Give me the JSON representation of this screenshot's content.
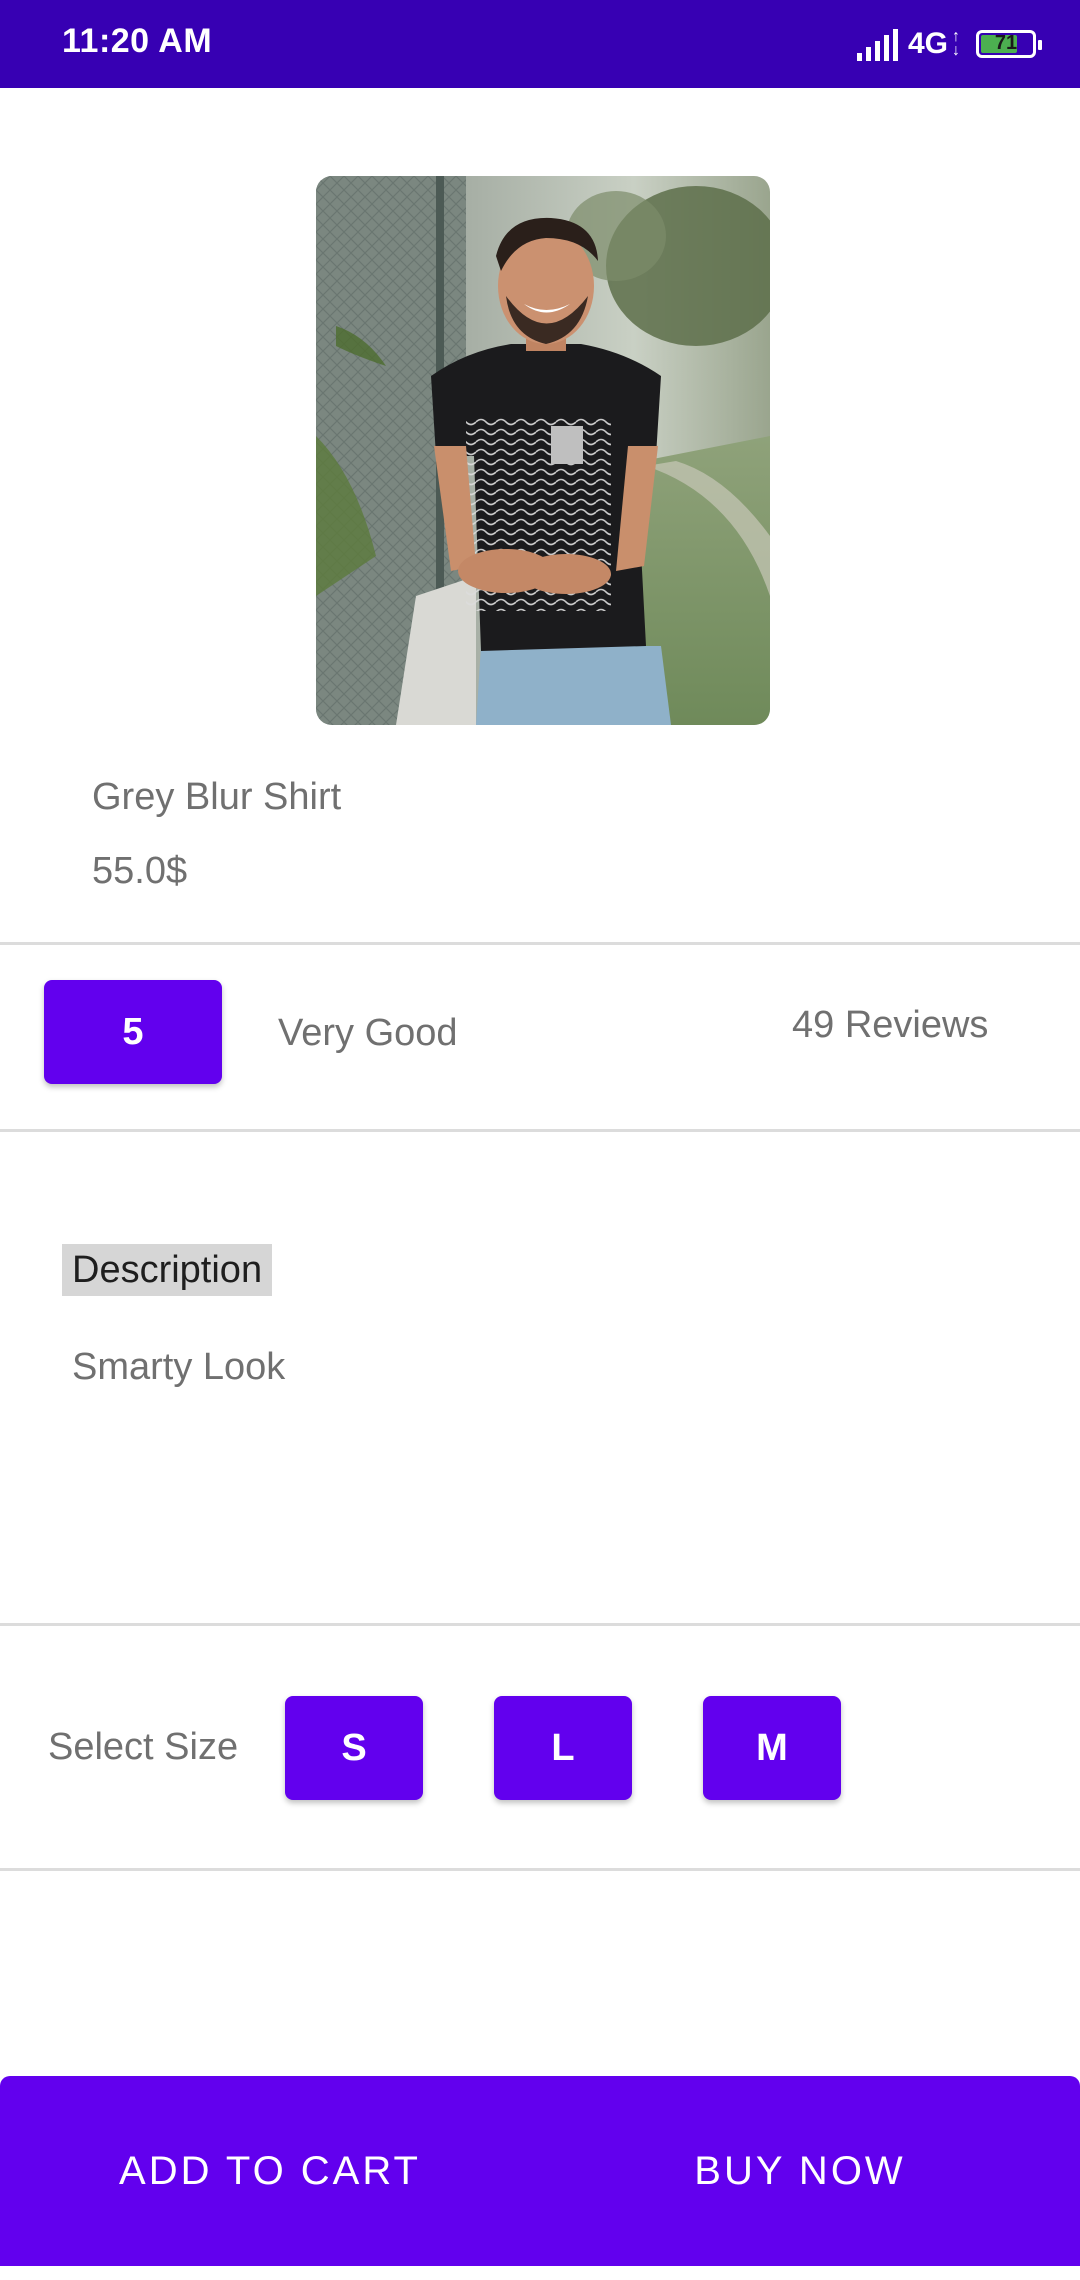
{
  "status_bar": {
    "time": "11:20 AM",
    "network": "4G",
    "battery": "71",
    "signal_icon": "signal-icon",
    "battery_icon": "battery-icon"
  },
  "product": {
    "name": "Grey Blur Shirt",
    "price": "55.0$"
  },
  "rating": {
    "score": "5",
    "label": "Very Good",
    "reviews": "49 Reviews"
  },
  "description": {
    "heading": "Description",
    "body": "Smarty Look"
  },
  "size": {
    "label": "Select Size",
    "options": [
      "S",
      "L",
      "M"
    ]
  },
  "actions": {
    "add_to_cart": "ADD TO CART",
    "buy_now": "BUY NOW"
  },
  "colors": {
    "status_bar": "#3700b3",
    "accent": "#6200ee"
  }
}
